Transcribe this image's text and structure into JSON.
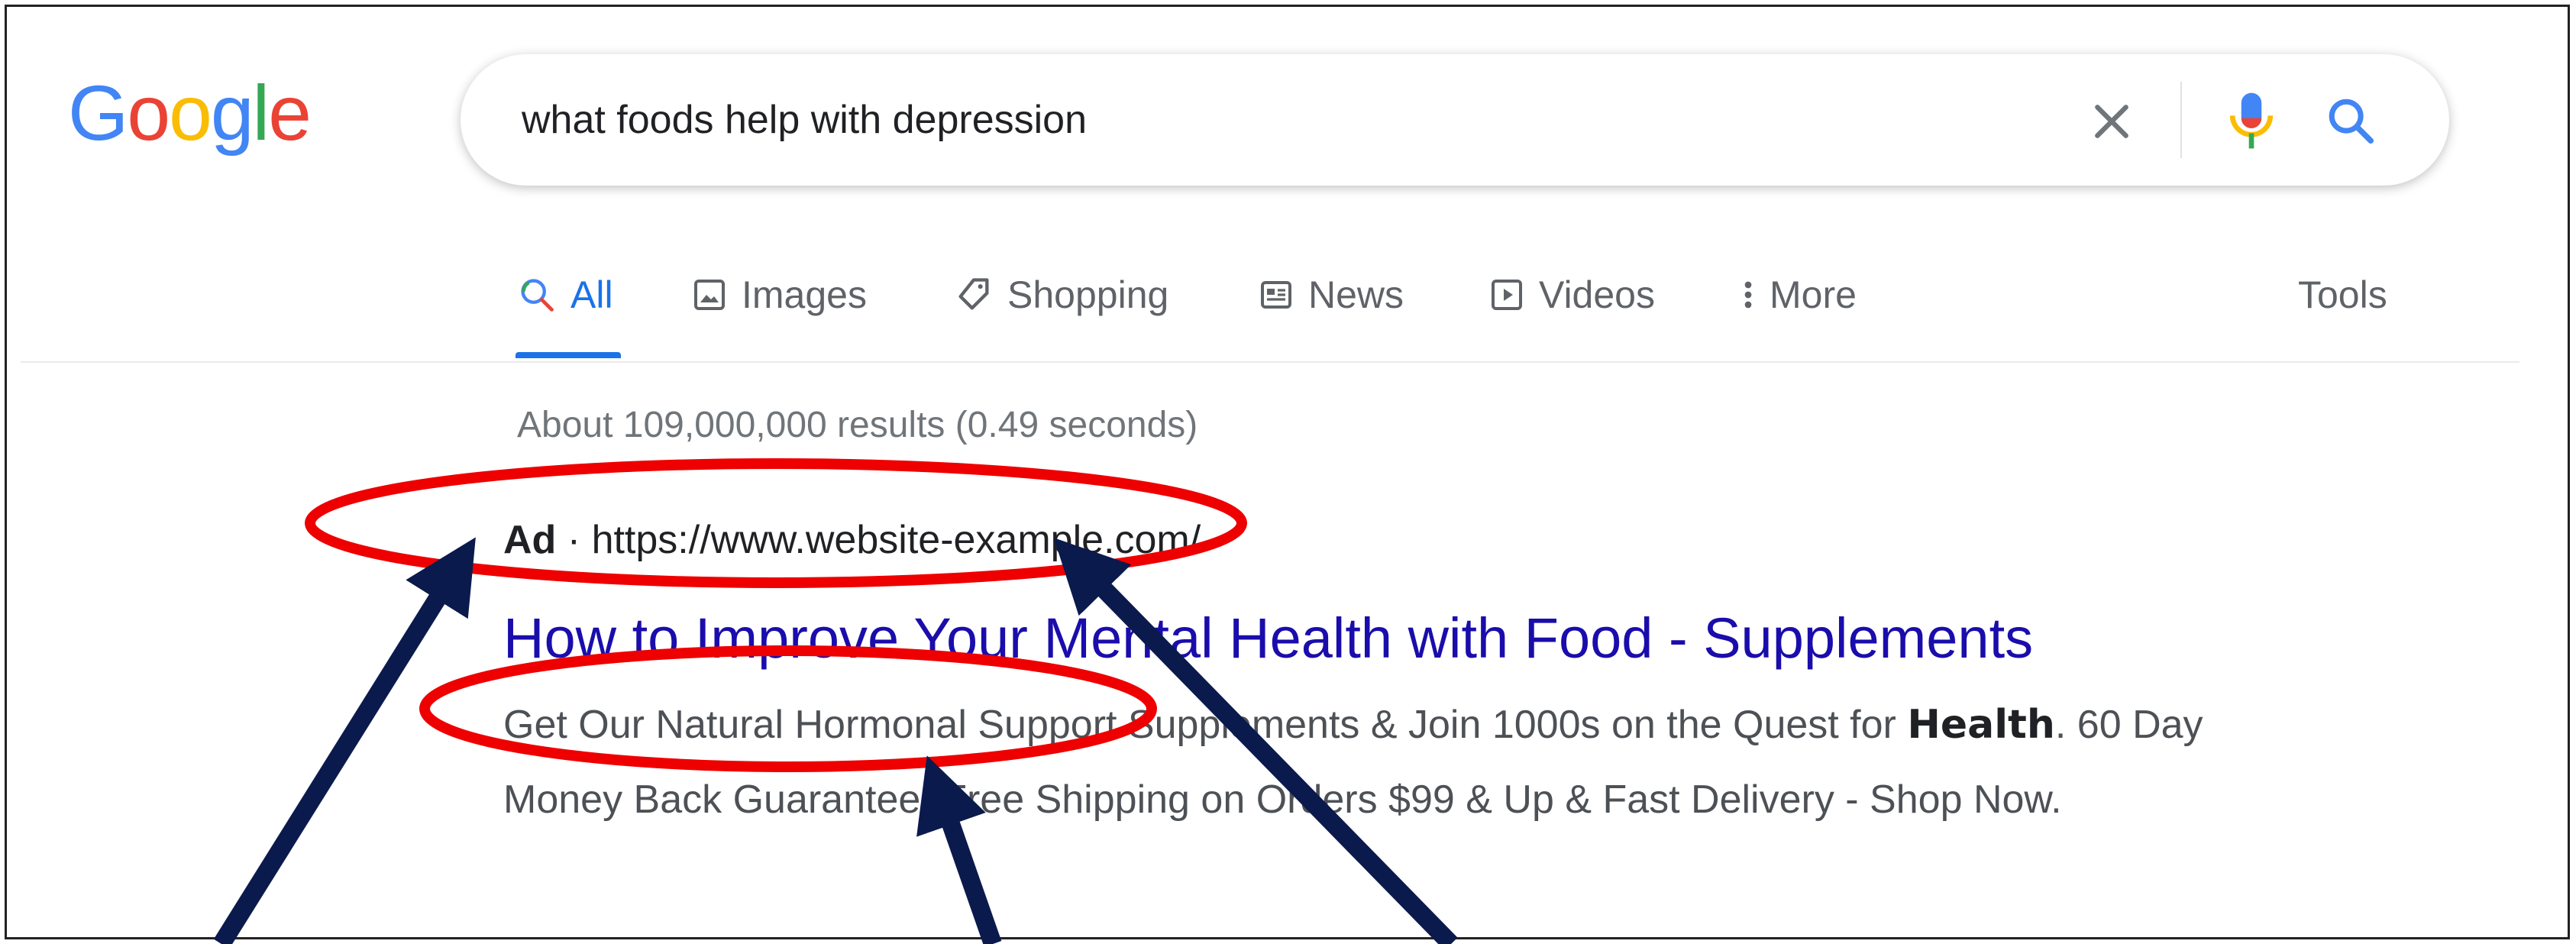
{
  "logo": {
    "letters": [
      "G",
      "o",
      "o",
      "g",
      "l",
      "e"
    ],
    "colors": [
      "#4285f4",
      "#ea4335",
      "#fbbc05",
      "#4285f4",
      "#34a853",
      "#ea4335"
    ]
  },
  "search": {
    "query": "what foods help with depression"
  },
  "icons": {
    "clear": "close-icon",
    "mic": "mic-icon",
    "search": "search-icon"
  },
  "tabs": [
    {
      "label": "All",
      "icon": "search-icon",
      "active": true
    },
    {
      "label": "Images",
      "icon": "image-icon"
    },
    {
      "label": "Shopping",
      "icon": "tag-icon"
    },
    {
      "label": "News",
      "icon": "news-icon"
    },
    {
      "label": "Videos",
      "icon": "play-icon"
    },
    {
      "label": "More",
      "icon": "more-vert-icon"
    },
    {
      "label": "Tools"
    }
  ],
  "results_stats": "About 109,000,000 results (0.49 seconds)",
  "ad_result": {
    "ad_label": "Ad",
    "separator": "·",
    "url": "https://www.website-example.com/",
    "title": "How to Improve Your Mental Health with Food - Supplements",
    "desc_line1_pre": "Get Our Natural Hormonal Support Supplements & Join 1000s on the Quest for ",
    "desc_line1_bold": "Health",
    "desc_line1_post": ". 60 Day",
    "desc_line2": "Money Back Guarantee, Free Shipping on Orders $99 & Up & Fast Delivery - Shop Now."
  },
  "colors": {
    "highlight": "#ee0000",
    "arrow": "#0b1a4d",
    "link": "#1a0dab",
    "accent": "#1a73e8"
  }
}
